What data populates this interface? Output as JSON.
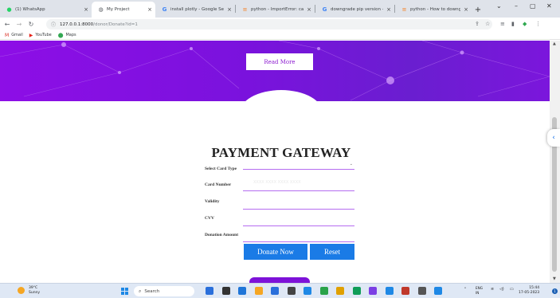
{
  "browser": {
    "tabs": [
      {
        "label": "(1) WhatsApp",
        "icon": "whatsapp-icon",
        "active": false
      },
      {
        "label": "My Project",
        "icon": "globe-icon",
        "active": true
      },
      {
        "label": "install plotly - Google Sear",
        "icon": "google-icon",
        "active": false
      },
      {
        "label": "python - ImportError: canno",
        "icon": "stackoverflow-icon",
        "active": false
      },
      {
        "label": "downgrade pip version - G",
        "icon": "google-icon",
        "active": false
      },
      {
        "label": "python - How to downgrade",
        "icon": "stackoverflow-icon",
        "active": false
      }
    ],
    "new_tab": "+",
    "window_controls": {
      "chevron": "⌄",
      "minimize": "–",
      "restore": "▢",
      "close": "✕"
    },
    "url_host": "127.0.0.1:8000",
    "url_path": "/donor/Donate?id=1",
    "bookmarks": [
      {
        "label": "Gmail",
        "icon": "gmail-icon"
      },
      {
        "label": "YouTube",
        "icon": "youtube-icon"
      },
      {
        "label": "Maps",
        "icon": "maps-icon"
      }
    ]
  },
  "page": {
    "read_more": "Read More",
    "title": "PAYMENT GATEWAY",
    "fields": [
      {
        "label": "Select Card Type"
      },
      {
        "label": "Card Number"
      },
      {
        "label": "Validity"
      },
      {
        "label": "CVV"
      },
      {
        "label": "Donation Amount"
      }
    ],
    "card_placeholder": "XXXX XXXX XXXX XXXX",
    "donate_button": "Donate Now",
    "reset_button": "Reset"
  },
  "taskbar": {
    "weather_temp": "39°C",
    "weather_desc": "Sunny",
    "search_label": "Search",
    "lang_top": "ENG",
    "lang_bottom": "IN",
    "time": "15:44",
    "date": "17-05-2023",
    "notification_count": "1",
    "app_colors": [
      "#2a6fdb",
      "#333333",
      "#1f75d8",
      "#f5a623",
      "#2a6fdb",
      "#444444",
      "#1e88e5",
      "#2aa34a",
      "#e0a000",
      "#0f9d58",
      "#7b3fe4",
      "#1e88e5",
      "#c0392b",
      "#555555",
      "#1e88e5"
    ]
  },
  "colors": {
    "accent_purple": "#8d0ee6",
    "button_blue": "#1a7be6"
  }
}
